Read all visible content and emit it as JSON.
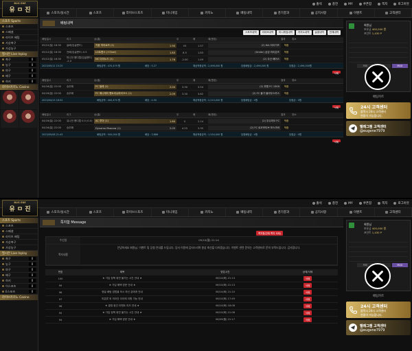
{
  "logo": {
    "main": "유 ㅁ 진",
    "sub": "BUG ENE"
  },
  "toplinks": [
    "출석",
    "충전",
    "MY",
    "쿠폰함",
    "쪽지",
    "로그아웃"
  ],
  "nav": [
    " 스포츠/실시간",
    "스포츠",
    "라이브스포츠",
    "미니게임",
    "카지노",
    "배팅내역",
    "경기결과",
    "공지사항",
    "이벤트",
    "고객센터"
  ],
  "sidebar": {
    "sports_head": "스포츠 Sports",
    "sports": [
      "스포츠",
      "스페셜",
      "라이브 배팅",
      "가상축구",
      "가상농구"
    ],
    "sports_counts": [
      "",
      "",
      "",
      "",
      ""
    ],
    "live_head": "필시안 Live Inplay",
    "live": [
      "축구",
      "농구",
      "야구",
      "배구",
      "하키",
      "이스포츠",
      "E스포츠"
    ],
    "live_counts": [
      "0",
      "0",
      "0",
      "0",
      "0",
      "0",
      "0"
    ],
    "casino_head": "라이브카지노 Casino"
  },
  "user": {
    "greet": "회원님",
    "balance_label": "보유금",
    "balance": "400,000 원",
    "point_label": "포인트",
    "point": "1,430 P",
    "rows": [
      "",
      "",
      "",
      "",
      "",
      ""
    ],
    "row_vals": [
      "",
      "",
      "",
      "",
      "",
      ""
    ],
    "btn_min": "MIN",
    "btn_max": "MAX",
    "btn_mid": "조회"
  },
  "right_title": "배팅카트",
  "call": {
    "title": "24시 고객센터",
    "desc1": "을학시 24시 고객센터",
    "desc2": "연중이 가능합니다."
  },
  "telegram": {
    "label": "텔레그램 고객센터",
    "id": "@eugene7979"
  },
  "shot1": {
    "title": "배팅내역",
    "tabs": [
      "스포츠내역",
      "라이브내역",
      "미니게임내역",
      "카지노내역",
      "슬롯내역",
      "전체내역"
    ],
    "head": [
      "배팅일시",
      "리그",
      "승(홈)",
      "무",
      "패",
      "패(원정)",
      "결과",
      "취소"
    ],
    "blocks": [
      {
        "rows": [
          {
            "date": "05/12(일) 18:30",
            "league": "슬배(잉글랜드)",
            "home": "키움 히어로즈 (1)",
            "hodd": "1.90",
            "draw": "VS",
            "dodd": "1.57",
            "away": "(2) KIA 타이거즈",
            "result": "적중"
          },
          {
            "date": "05/12(일) 18:30",
            "league": "언배(잉글랜드) 0.5",
            "home": "LG트윈스 (+Over)",
            "hodd": "1.83",
            "draw": "8.5",
            "dodd": "1.83",
            "away": "(Under) 삼성 라이온즈",
            "result": "적중"
          },
          {
            "date": "05/12(일) 18:30",
            "league": "미니언 핸디캡(잉글랜드) -2.0",
            "home": "NC 다이노스 (1)",
            "hodd": "1.76",
            "draw": "-2.00",
            "dodd": "1.49",
            "away": "(2) 두산 베어스",
            "result": "적중"
          }
        ],
        "foot": [
          "2023/05/11 15:25",
          "배팅금액 : 470,479 원",
          "배당 : 5.27",
          "예상적중금액 : 2,496,000 원",
          "당첨배팅금 : 2,496,000 원",
          "당첨금 : 2,496,000원"
        ]
      },
      {
        "rows": [
          {
            "date": "04/16(일) 22:00",
            "league": "승무패",
            "home": "FC 빌레 (1)",
            "hodd": "2.04",
            "draw": "3.30",
            "dodd": "3.54",
            "away": "(2) 부평 FC 1300",
            "result": "적중"
          },
          {
            "date": "04/16(일) 22:00",
            "league": "승무패",
            "home": "FC 메니체미 헨트리슈퍼리크스 (1)",
            "hodd": "2.09",
            "draw": "3.30",
            "dodd": "3.62",
            "away": "(2) FC 몰가 블라우스카스",
            "result": "적중"
          }
        ],
        "foot": [
          "2023/04/13 18:52",
          "배팅금액 : 400,470 원",
          "배당 : 4.50",
          "예상적중금액 : 2,210,000 원",
          "당첨배팅금 : 0원",
          "당첨금 : 0원"
        ]
      },
      {
        "rows": [
          {
            "date": "04/16(일) 22:00",
            "league": "유니언 핸디캡 0.0 (0.0)",
            "home": "AC 루아 (1)",
            "hodd": "1.60",
            "draw": "0",
            "dodd": "2.14",
            "away": "(2) 우수마오 FC",
            "result": "적중"
          },
          {
            "date": "04/16(일) 22:00",
            "league": "승무패",
            "home": "Dynamo Moscow (1)",
            "hodd": "2.05",
            "draw": "4.25",
            "dodd": "3.35",
            "away": "(2) FC 로코모티브 모스크바",
            "result": "적중"
          }
        ],
        "foot": [
          "2023/05/08 21:43",
          "배팅금액 : 500,000 원",
          "배당 : 3.886",
          "예상적중금액 : 1,534,000 원",
          "당첨배팅금 : 0원",
          "당첨금 : 0원"
        ]
      }
    ],
    "cancel_label": "취소",
    "delete_label": "삭제"
  },
  "shot2": {
    "title": "쪽지함 Message",
    "top_btn": "쪽지함(전체 쪽지 삭제)",
    "info": [
      {
        "k": "수신일",
        "v": "05/10(월) 21:14"
      },
      {
        "k": "쪽지내용",
        "v": "안녕하세요 회원님. 이벤트 및 당첨 안내를 드립니다. 당사 이용에 감사드리며 항상 최선을 다하겠습니다. 이벤트 관련 문의는 고객센터로 문의 부탁드립니다. 감사합니다."
      }
    ],
    "head": [
      "번호",
      "제목",
      "받은시간",
      "상태/삭제"
    ],
    "rows": [
      {
        "no": "100",
        "title": "★ 가입 정책 위반 불가는 시간 안내 ★",
        "time": "06/10(화) 21:13",
        "btn": "삭제"
      },
      {
        "no": "99",
        "title": "★ 가입 혜택 방문 안내 ★",
        "time": "06/10(화) 21:13",
        "btn": "삭제"
      },
      {
        "no": "98",
        "title": "정밀 배팅 방법을 하시 하신 분에게 안내",
        "time": "06/10(화) 21:10",
        "btn": "삭제"
      },
      {
        "no": "97",
        "title": "미분류 외 미리안 이이에 이원 가능 안내",
        "time": "06/10(화) 17:49",
        "btn": "삭제"
      },
      {
        "no": "96",
        "title": "★ 결정 중간 이벤트 리조 안내 ★",
        "time": "06/10(화) 18:08",
        "btn": "삭제"
      },
      {
        "no": "95",
        "title": "★ 가입 정책 위반 불가는 시간 안내 ★",
        "time": "06/10(화) 21:08",
        "btn": "삭제"
      },
      {
        "no": "94",
        "title": "★ 가입 혜택 방문 안내 ★",
        "time": "06/09(월) 21:17",
        "btn": "삭제"
      }
    ]
  }
}
